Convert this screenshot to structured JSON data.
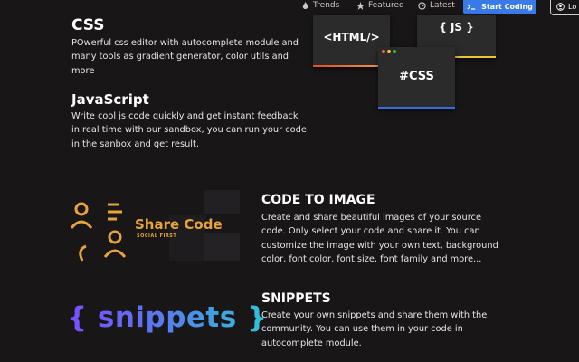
{
  "nav": {
    "trends": "Trends",
    "featured": "Featured",
    "latest": "Latest",
    "start_coding": "Start Coding",
    "login": "Lo"
  },
  "css_section": {
    "title": "CSS",
    "lines": [
      "POwerful css editor with autocomplete module and",
      "many tools as gradient generator, color utils and",
      "more"
    ]
  },
  "js_section": {
    "title": "JavaScript",
    "lines": [
      "Write cool js code quickly and get instant feedback",
      "in real time with our sandbox, you can run your code",
      "in the sanbox and get result."
    ]
  },
  "windows": {
    "html_label": "<HTML/>",
    "js_label": "{ JS }",
    "css_label": "#CSS"
  },
  "code_to_image": {
    "title": "CODE TO IMAGE",
    "brand": "Share Code",
    "brand_sub": "SOCIAL FIRST",
    "lines": [
      "Create and share beautiful images of your source",
      "code. Only select your code and share it. You can",
      "customize the image with your own text, background",
      "color, font color, font size, font family and more..."
    ]
  },
  "snippets": {
    "title": "SNIPPETS",
    "logo_text": "{ snippets }",
    "lines": [
      "Create your own snippets and share them with the",
      "community. You can use them in your code in",
      "autocomplete module."
    ]
  },
  "colors": {
    "background": "#181617",
    "accent_blue": "#3a7ae8",
    "brand_orange": "#e8a33a",
    "snippets_gradient": [
      "#7b4dff",
      "#2ec4d6"
    ]
  }
}
